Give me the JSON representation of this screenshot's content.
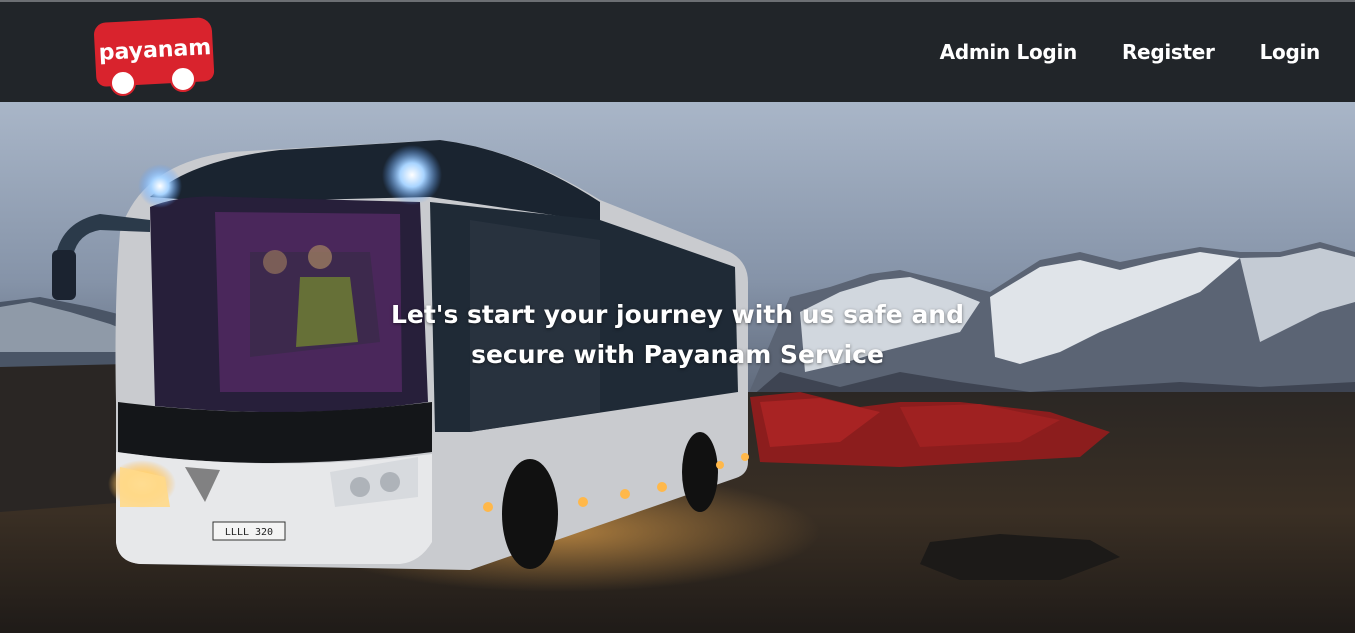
{
  "brand": {
    "logo_text": "payanam",
    "colors": {
      "logo_red": "#d9232d",
      "navbar_bg": "#212529",
      "text": "#ffffff"
    }
  },
  "nav": {
    "links": [
      {
        "label": "Admin Login"
      },
      {
        "label": "Register"
      },
      {
        "label": "Login"
      }
    ]
  },
  "hero": {
    "headline_line1": "Let's start your journey with us safe and",
    "headline_line2": "secure with Payanam Service",
    "bus_plate": "LLLL 320"
  }
}
